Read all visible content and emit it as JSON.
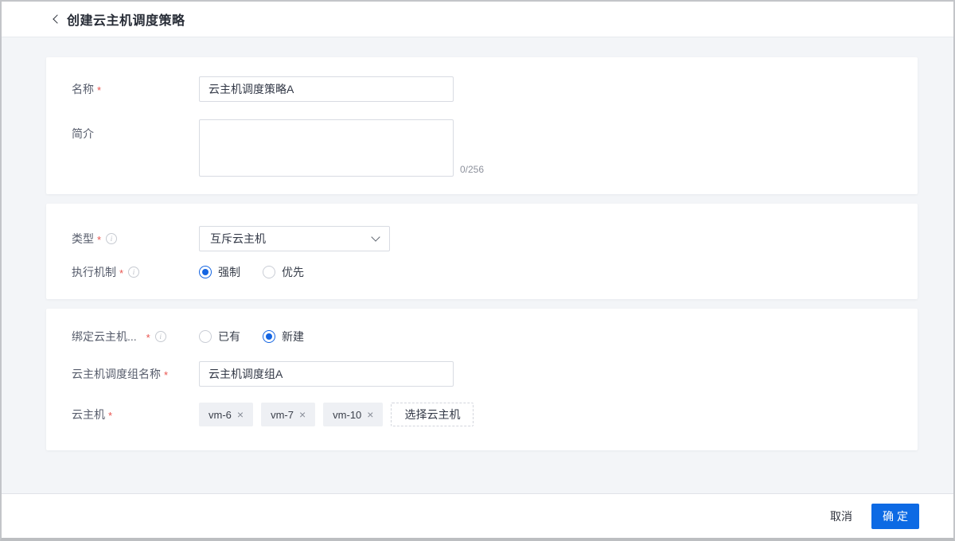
{
  "header": {
    "title": "创建云主机调度策略"
  },
  "basic_card": {
    "name_label": "名称",
    "name_value": "云主机调度策略A",
    "desc_label": "简介",
    "desc_value": "",
    "desc_counter": "0/256"
  },
  "type_card": {
    "type_label": "类型",
    "type_value": "互斥云主机",
    "mechanism_label": "执行机制",
    "mechanism_options": [
      {
        "label": "强制",
        "selected": true
      },
      {
        "label": "优先",
        "selected": false
      }
    ]
  },
  "bind_card": {
    "bind_label": "绑定云主机...",
    "bind_options": [
      {
        "label": "已有",
        "selected": false
      },
      {
        "label": "新建",
        "selected": true
      }
    ],
    "group_name_label": "云主机调度组名称",
    "group_name_value": "云主机调度组A",
    "hosts_label": "云主机",
    "host_tags": [
      "vm-6",
      "vm-7",
      "vm-10"
    ],
    "tag_remove_icon": "×",
    "select_hosts_button": "选择云主机"
  },
  "footer": {
    "cancel_label": "取消",
    "confirm_label": "确定"
  },
  "required_marker": "*",
  "info_icon_glyph": "i",
  "colors": {
    "primary": "#0d6ae4",
    "required": "#e9534e",
    "page_background": "#f3f5f8"
  }
}
